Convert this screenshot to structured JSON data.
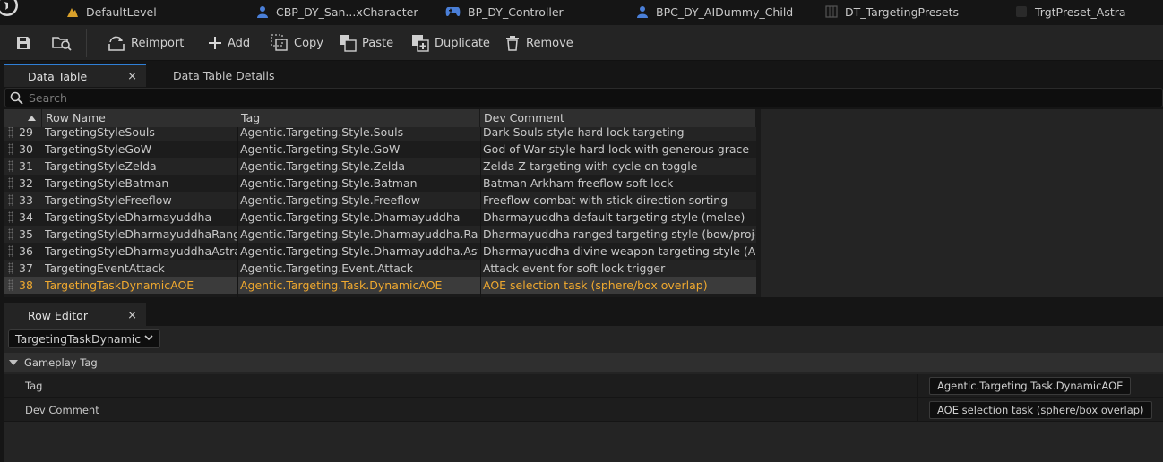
{
  "document_tabs": [
    {
      "label": "DefaultLevel",
      "icon": "level-icon"
    },
    {
      "label": "CBP_DY_San...xCharacter",
      "icon": "person-icon"
    },
    {
      "label": "BP_DY_Controller",
      "icon": "gamepad-icon"
    },
    {
      "label": "BPC_DY_AIDummy_Child",
      "icon": "person-icon"
    },
    {
      "label": "DT_TargetingPresets",
      "icon": "datatable-icon"
    },
    {
      "label": "TrgtPreset_Astra",
      "icon": "asset-icon"
    }
  ],
  "toolbar": {
    "reimport": "Reimport",
    "add": "Add",
    "copy": "Copy",
    "paste": "Paste",
    "duplicate": "Duplicate",
    "remove": "Remove"
  },
  "panel_tabs": {
    "data_table": "Data Table",
    "data_table_details": "Data Table Details",
    "row_editor": "Row Editor",
    "close_glyph": "×"
  },
  "search": {
    "placeholder": "Search"
  },
  "table": {
    "columns": [
      "Row Name",
      "Tag",
      "Dev Comment"
    ],
    "rows": [
      {
        "num": "29",
        "name": "TargetingStyleSouls",
        "tag": "Agentic.Targeting.Style.Souls",
        "comment": "Dark Souls-style hard lock targeting"
      },
      {
        "num": "30",
        "name": "TargetingStyleGoW",
        "tag": "Agentic.Targeting.Style.GoW",
        "comment": "God of War style hard lock with generous grace"
      },
      {
        "num": "31",
        "name": "TargetingStyleZelda",
        "tag": "Agentic.Targeting.Style.Zelda",
        "comment": "Zelda Z-targeting with cycle on toggle"
      },
      {
        "num": "32",
        "name": "TargetingStyleBatman",
        "tag": "Agentic.Targeting.Style.Batman",
        "comment": "Batman Arkham freeflow soft lock"
      },
      {
        "num": "33",
        "name": "TargetingStyleFreeflow",
        "tag": "Agentic.Targeting.Style.Freeflow",
        "comment": "Freeflow combat with stick direction sorting"
      },
      {
        "num": "34",
        "name": "TargetingStyleDharmayuddha",
        "tag": "Agentic.Targeting.Style.Dharmayuddha",
        "comment": "Dharmayuddha default targeting style (melee)"
      },
      {
        "num": "35",
        "name": "TargetingStyleDharmayuddhaRanged",
        "tag": "Agentic.Targeting.Style.Dharmayuddha.Ranged",
        "comment": "Dharmayuddha ranged targeting style (bow/projectiles)"
      },
      {
        "num": "36",
        "name": "TargetingStyleDharmayuddhaAstra",
        "tag": "Agentic.Targeting.Style.Dharmayuddha.Astra",
        "comment": "Dharmayuddha divine weapon targeting style (Astras)"
      },
      {
        "num": "37",
        "name": "TargetingEventAttack",
        "tag": "Agentic.Targeting.Event.Attack",
        "comment": "Attack event for soft lock trigger"
      },
      {
        "num": "38",
        "name": "TargetingTaskDynamicAOE",
        "tag": "Agentic.Targeting.Task.DynamicAOE",
        "comment": "AOE selection task (sphere/box overlap)"
      }
    ]
  },
  "row_editor": {
    "selected_row": "TargetingTaskDynamic",
    "category": "Gameplay Tag",
    "properties": [
      {
        "label": "Tag",
        "value": "Agentic.Targeting.Task.DynamicAOE"
      },
      {
        "label": "Dev Comment",
        "value": "AOE selection task (sphere/box overlap)"
      }
    ]
  },
  "colors": {
    "accent_blue": "#2f7fd6",
    "selected_text": "#f0a92f",
    "panel_bg": "#242424",
    "window_bg": "#151515"
  }
}
